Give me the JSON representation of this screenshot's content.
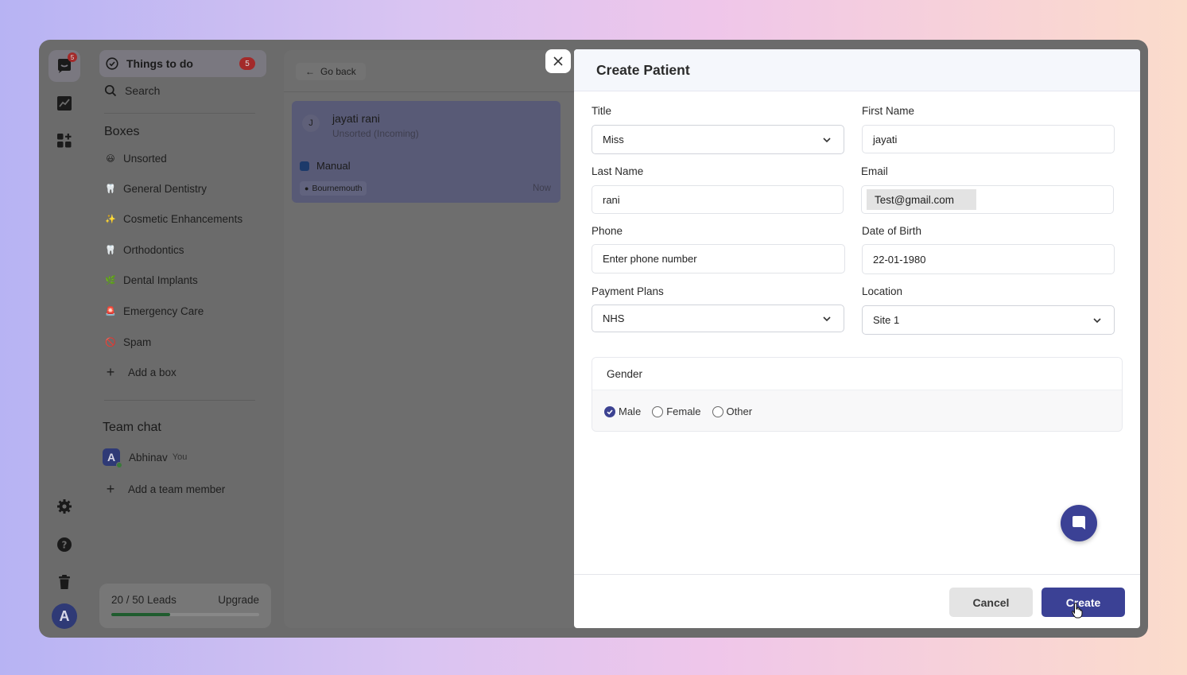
{
  "rail": {
    "logo_badge": "5",
    "avatar_initial": "A",
    "icons": [
      "app-logo-icon",
      "analytics-icon",
      "widgets-icon",
      "settings-icon",
      "help-icon",
      "trash-icon"
    ]
  },
  "sidebar": {
    "things_to_do": "Things to do",
    "things_count": "5",
    "search": "Search",
    "boxes_title": "Boxes",
    "boxes": [
      {
        "emoji": "😃",
        "label": "Unsorted"
      },
      {
        "emoji": "🦷",
        "label": "General Dentistry"
      },
      {
        "emoji": "✨",
        "label": "Cosmetic Enhancements"
      },
      {
        "emoji": "🦷",
        "label": "Orthodontics"
      },
      {
        "emoji": "🌿",
        "label": "Dental Implants"
      },
      {
        "emoji": "🚨",
        "label": "Emergency Care"
      },
      {
        "emoji": "🚫",
        "label": "Spam"
      }
    ],
    "add_box": "Add a box",
    "team_chat_title": "Team chat",
    "chat_user": {
      "initial": "A",
      "name": "Abhinav",
      "tag": "You"
    },
    "add_team_member": "Add a team member",
    "leads": {
      "text": "20 / 50 Leads",
      "upgrade": "Upgrade",
      "fraction": 0.4
    }
  },
  "middle": {
    "go_back": "Go back",
    "lead": {
      "initial": "J",
      "name": "jayati rani",
      "status": "Unsorted (Incoming)",
      "source": "Manual",
      "location": "Bournemouth",
      "time": "Now"
    }
  },
  "modal": {
    "title": "Create Patient",
    "fields": {
      "title_label": "Title",
      "title_value": "Miss",
      "first_name_label": "First Name",
      "first_name_value": "jayati",
      "last_name_label": "Last Name",
      "last_name_value": "rani",
      "email_label": "Email",
      "email_value": "Test@gmail.com",
      "phone_label": "Phone",
      "phone_placeholder": "Enter phone number",
      "dob_label": "Date of Birth",
      "dob_value": "22-01-1980",
      "payment_label": "Payment Plans",
      "payment_value": "NHS",
      "location_label": "Location",
      "location_value": "Site 1"
    },
    "gender": {
      "label": "Gender",
      "options": [
        "Male",
        "Female",
        "Other"
      ],
      "selected": "Male"
    },
    "cancel": "Cancel",
    "create": "Create"
  },
  "colors": {
    "primary": "#3b4195",
    "badge": "#c62828",
    "progress": "#2e8b46"
  }
}
